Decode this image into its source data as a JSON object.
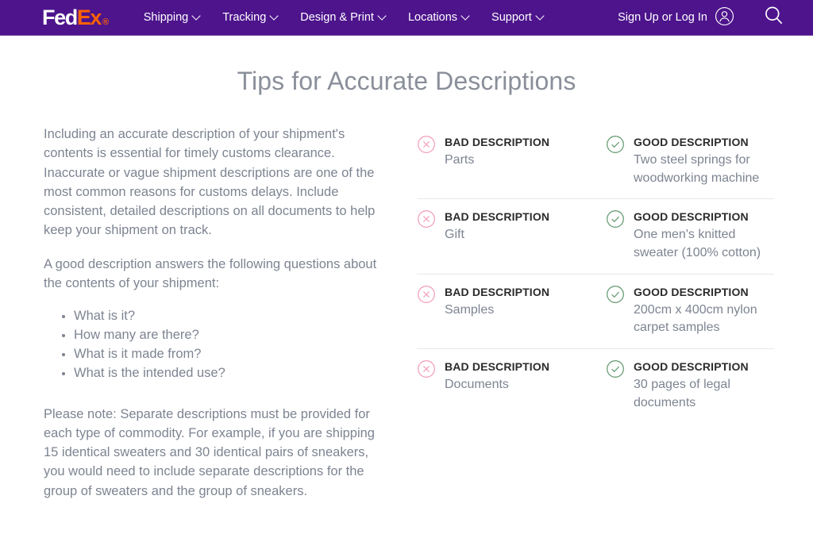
{
  "header": {
    "logo": {
      "fed": "Fed",
      "ex": "Ex",
      "tm": "®"
    },
    "nav": [
      {
        "label": "Shipping",
        "icon": "chevron-down-icon"
      },
      {
        "label": "Tracking",
        "icon": "chevron-down-icon"
      },
      {
        "label": "Design & Print",
        "icon": "chevron-down-icon"
      },
      {
        "label": "Locations",
        "icon": "chevron-down-icon"
      },
      {
        "label": "Support",
        "icon": "chevron-down-icon"
      }
    ],
    "sign_in_label": "Sign Up or Log In",
    "account_icon": "user-avatar-icon",
    "search_icon": "search-icon",
    "background_color": "#4D148C",
    "accent_color": "#FF6200"
  },
  "page": {
    "title": "Tips for Accurate Descriptions"
  },
  "left": {
    "paragraph_1": "Including an accurate description of your shipment's contents is essential for timely customs clearance. Inaccurate or vague shipment descriptions are one of the most common reasons for customs delays. Include consistent, detailed descriptions on all documents to help keep your shipment on track.",
    "paragraph_2": "A good description answers the following questions about the contents of your shipment:",
    "questions": [
      "What is it?",
      "How many are there?",
      "What is it made from?",
      "What is the intended use?"
    ],
    "note": "Please note: Separate descriptions must be provided for each type of commodity. For example, if you are shipping 15 identical sweaters and 30 identical pairs of sneakers, you would need to include separate descriptions for the group of sweaters and the group of sneakers."
  },
  "comparison": {
    "bad_label": "BAD DESCRIPTION",
    "good_label": "GOOD DESCRIPTION",
    "bad_icon": "circle-x-icon",
    "good_icon": "circle-check-icon",
    "bad_icon_color": "#f2a3bb",
    "good_icon_color": "#6a9e77",
    "rows": [
      {
        "bad": "Parts",
        "good": "Two steel springs for woodworking machine"
      },
      {
        "bad": "Gift",
        "good": "One men's knitted sweater (100% cotton)"
      },
      {
        "bad": "Samples",
        "good": "200cm x 400cm nylon carpet samples"
      },
      {
        "bad": "Documents",
        "good": "30 pages of legal documents"
      }
    ]
  }
}
